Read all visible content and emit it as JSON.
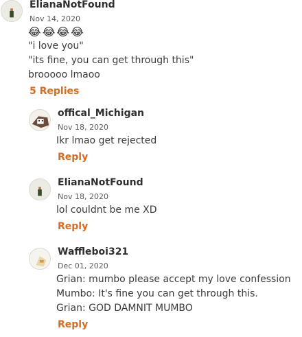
{
  "top_comment": {
    "username": "ElianaNotFound",
    "date": "Nov 14, 2020",
    "emojis": [
      "😂",
      "😂",
      "😂",
      "😂"
    ],
    "lines": [
      "\"i love you\"",
      "\"its fine, you can get through this\"",
      "brooooo lmaoo"
    ],
    "replies_label": "5 Replies"
  },
  "replies": [
    {
      "username": "offical_Michigan",
      "date": "Nov 18, 2020",
      "lines": [
        "Ikr lmao get rejected"
      ],
      "reply_label": "Reply"
    },
    {
      "username": "ElianaNotFound",
      "date": "Nov 18, 2020",
      "lines": [
        "lol couldnt be me XD"
      ],
      "reply_label": "Reply"
    },
    {
      "username": "Waffleboi321",
      "date": "Dec 01, 2020",
      "lines": [
        "Grian: mumbo please accept my love confession",
        "Mumbo: It's fine you can get through this.",
        "Grian: GOD DAMNIT MUMBO"
      ],
      "reply_label": "Reply"
    }
  ],
  "colors": {
    "accent": "#e06a1a",
    "text": "#3a3a3a",
    "meta": "#5a5a5a"
  }
}
